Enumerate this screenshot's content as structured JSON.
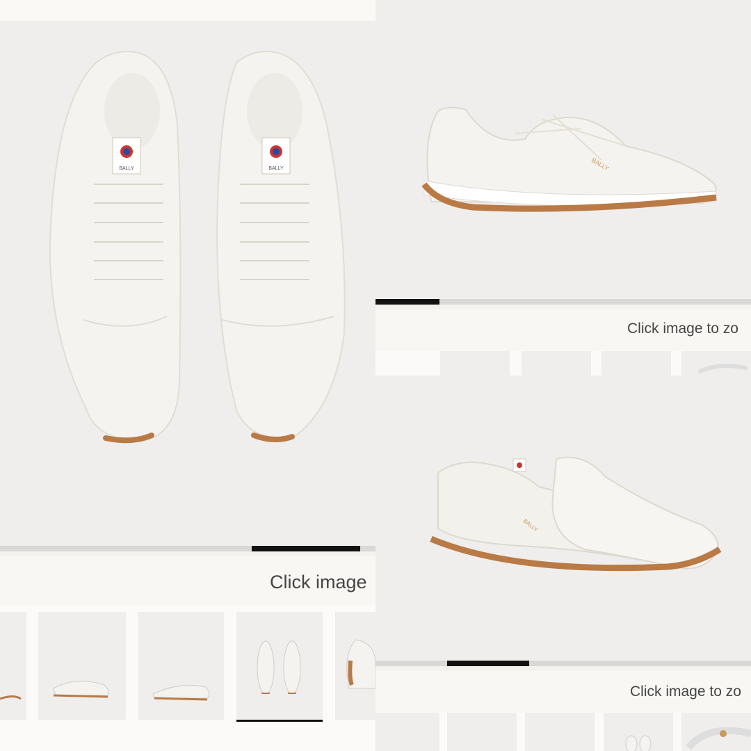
{
  "panel_a": {
    "caption": "Click image",
    "progress_fraction_start": 0.67,
    "progress_fraction_end": 0.96,
    "brand_mark": "BALLY",
    "thumbnails": [
      "thumb-1",
      "thumb-2",
      "thumb-3",
      "thumb-4",
      "thumb-5"
    ],
    "active_thumbnail": 3
  },
  "panel_b": {
    "caption": "Click image to zo",
    "progress_fraction_start": 0.0,
    "progress_fraction_end": 0.17,
    "brand_mark": "BALLY"
  },
  "panel_c": {
    "caption": "Click image to zo",
    "progress_fraction_start": 0.19,
    "progress_fraction_end": 0.41,
    "brand_mark": "BALLY"
  },
  "colors": {
    "background": "#efeeed",
    "shoe": "#f4f3ef",
    "sole": "#b97a45",
    "progress_track": "#d9d8d6",
    "progress_fill": "#111111",
    "caption_text": "#444444"
  }
}
